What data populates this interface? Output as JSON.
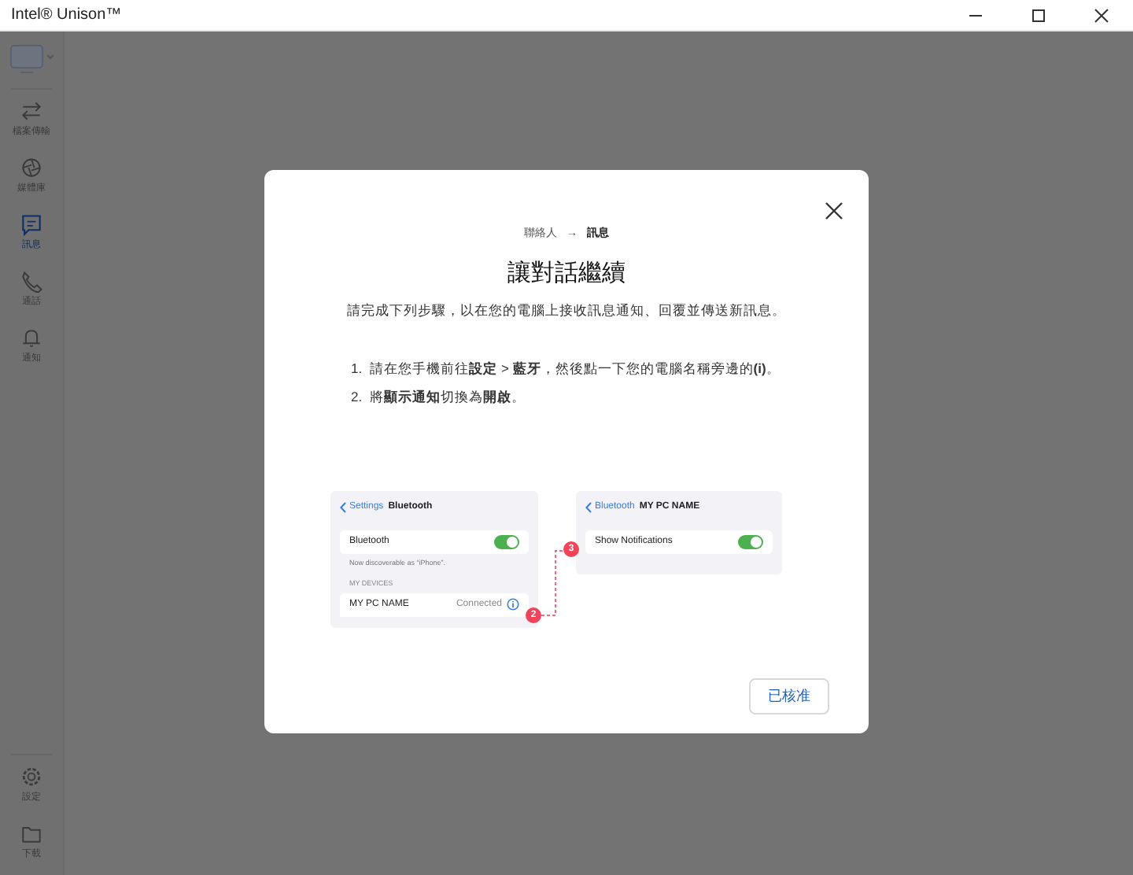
{
  "window": {
    "title": "Intel® Unison™"
  },
  "sidebar": {
    "items": [
      {
        "label": "檔案傳輸",
        "selected": false
      },
      {
        "label": "媒體庫",
        "selected": false
      },
      {
        "label": "訊息",
        "selected": true
      },
      {
        "label": "通話",
        "selected": false
      },
      {
        "label": "通知",
        "selected": false
      }
    ],
    "bottom_items": [
      {
        "label": "設定",
        "selected": false
      },
      {
        "label": "下載",
        "selected": false
      }
    ]
  },
  "dialog": {
    "breadcrumb": {
      "items": [
        "聯絡人",
        "訊息"
      ],
      "separator": "→"
    },
    "title": "讓對話繼續",
    "description": "請完成下列步驟，以在您的電腦上接收訊息通知、回覆並傳送新訊息。",
    "steps": [
      {
        "number": "1.",
        "text": "請在您手機前往**設定** > **藍牙**，然後點一下您的電腦名稱旁邊的**(i)**。"
      },
      {
        "number": "2.",
        "text": "將**顯示通知**切換為**開啟**。"
      }
    ],
    "phone_left": {
      "back": "Settings",
      "title": "Bluetooth",
      "toggle_row": {
        "label": "Bluetooth",
        "on": true
      },
      "caption": "Now discoverable as “iPhone”.",
      "section": "MY DEVICES",
      "device": {
        "name": "MY PC NAME",
        "status": "Connected"
      },
      "badge": "2"
    },
    "phone_right": {
      "back": "Bluetooth",
      "title": "MY PC NAME",
      "toggle_row": {
        "label": "Show Notifications",
        "on": true
      },
      "badge": "3"
    },
    "button": "已核准"
  }
}
